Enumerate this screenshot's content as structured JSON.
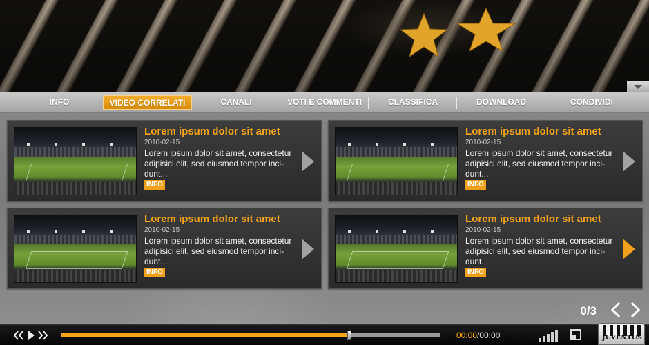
{
  "tabs": [
    {
      "label": "INFO"
    },
    {
      "label": "VIDEO CORRELATI"
    },
    {
      "label": "CANALI"
    },
    {
      "label": "VOTI E COMMENTI"
    },
    {
      "label": "CLASSIFICA"
    },
    {
      "label": "DOWNLOAD"
    },
    {
      "label": "CONDIVIDI"
    }
  ],
  "active_tab": "VIDEO CORRELATI",
  "cards": [
    {
      "title": "Lorem ipsum dolor sit amet",
      "date": "2010-02-15",
      "text": "Lorem ipsum dolor sit amet, consectetur adipisici elit, sed eiusmod tempor inci-dunt...",
      "info_label": "INFO"
    },
    {
      "title": "Lorem ipsum dolor sit amet",
      "date": "2010-02-15",
      "text": "Lorem ipsum dolor sit amet, consectetur adipisici elit, sed eiusmod tempor inci-dunt...",
      "info_label": "INFO"
    },
    {
      "title": "Lorem ipsum dolor sit amet",
      "date": "2010-02-15",
      "text": "Lorem ipsum dolor sit amet, consectetur adipisici elit, sed eiusmod tempor inci-dunt...",
      "info_label": "INFO"
    },
    {
      "title": "Lorem ipsum dolor sit amet",
      "date": "2010-02-15",
      "text": "Lorem ipsum dolor sit amet, consectetur adipisici elit, sed eiusmod tempor inci-dunt...",
      "info_label": "INFO"
    }
  ],
  "pager": {
    "count": "0/3"
  },
  "player": {
    "current_time": "00:00",
    "total_time": "/00:00",
    "progress": 0.76
  },
  "logo_text": "JUVENTUS",
  "colors": {
    "accent": "#f4a41a",
    "panel": "#7f7f7f",
    "card": "#333333"
  },
  "icons": [
    "collapse-icon",
    "rewind-icon",
    "play-icon",
    "fast-forward-icon",
    "volume-icon",
    "fullscreen-icon",
    "chevron-left-icon",
    "chevron-right-icon"
  ]
}
